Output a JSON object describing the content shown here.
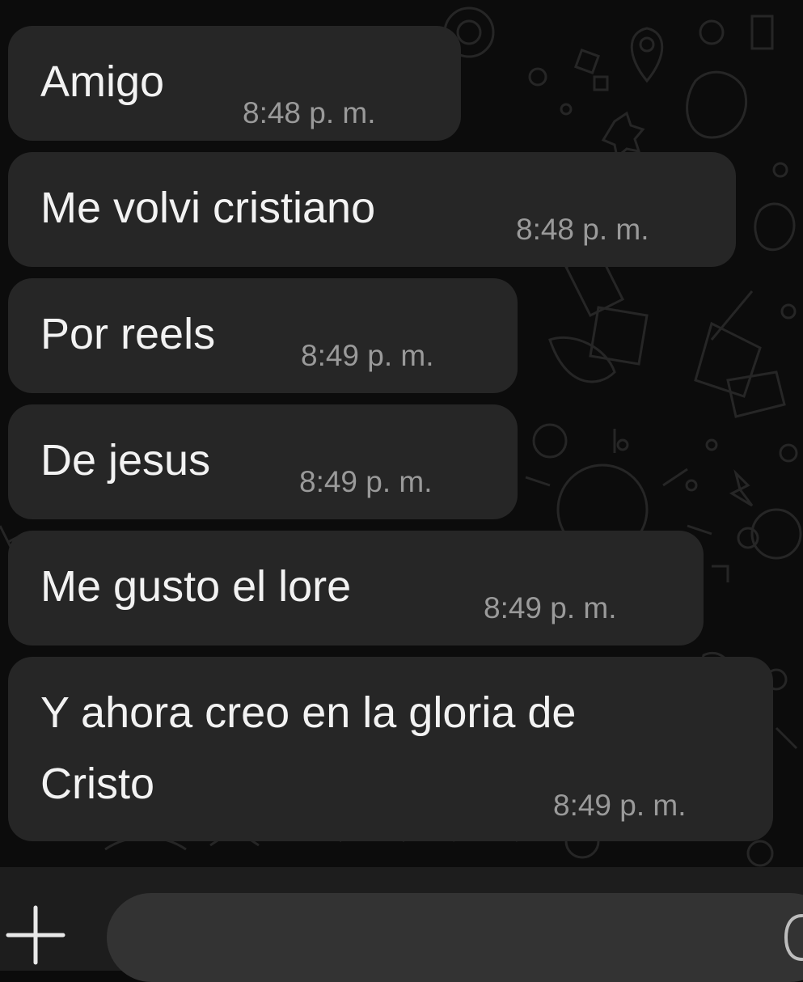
{
  "chat": {
    "messages": [
      {
        "text": "Amigo",
        "time": "8:48 p. m."
      },
      {
        "text": "Me volvi cristiano",
        "time": "8:48 p. m."
      },
      {
        "text": "Por reels",
        "time": "8:49 p. m."
      },
      {
        "text": "De jesus",
        "time": "8:49 p. m."
      },
      {
        "text": "Me gusto el lore",
        "time": "8:49 p. m."
      },
      {
        "text_line1": "Y ahora creo en la gloria de",
        "text_line2": "Cristo",
        "time": "8:49 p. m."
      }
    ]
  },
  "composer": {
    "placeholder": "",
    "plus_icon": "plus-icon",
    "sticker_icon": "sticker-icon"
  },
  "colors": {
    "background": "#0c0c0c",
    "bubble": "#262626",
    "text": "#f2f2f2",
    "timestamp": "#9a9a9a",
    "input_bar": "#1d1d1d",
    "input_field": "#333333"
  }
}
